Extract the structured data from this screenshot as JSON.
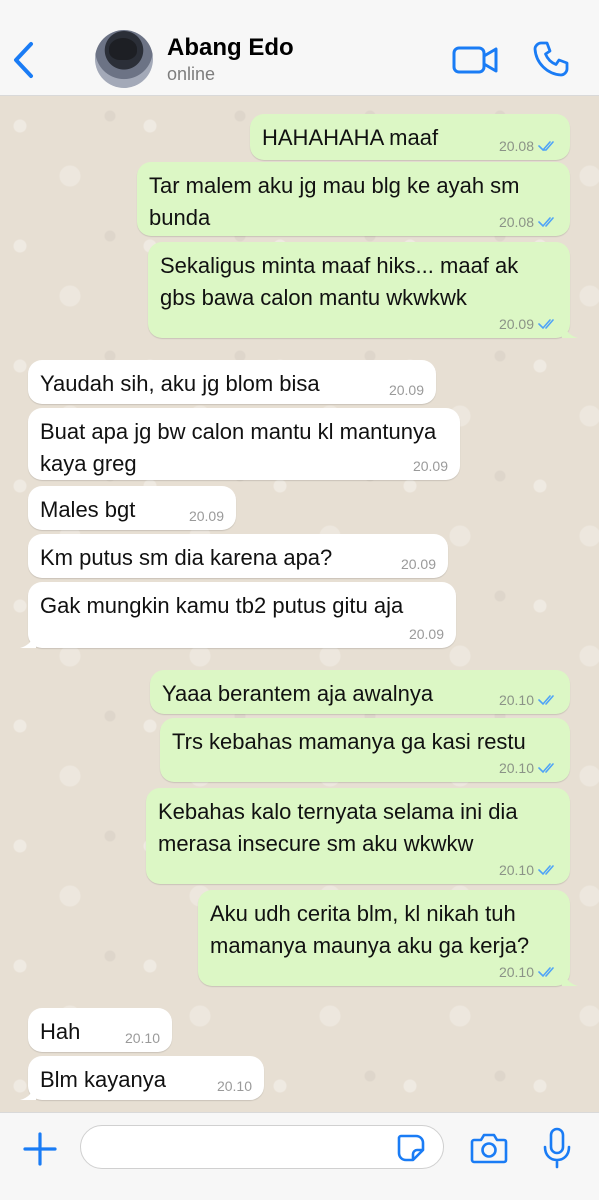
{
  "header": {
    "contact_name": "Abang Edo",
    "status": "online",
    "accent_color": "#1a7cf5"
  },
  "icons": {
    "back": "chevron-left-icon",
    "video": "video-camera-icon",
    "call": "phone-icon",
    "plus": "plus-icon",
    "sticker": "sticker-icon",
    "camera": "camera-icon",
    "mic": "microphone-icon"
  },
  "messages": [
    {
      "direction": "out",
      "text": "HAHAHAHA maaf",
      "time": "20.08",
      "read": true
    },
    {
      "direction": "out",
      "text": "Tar malem aku jg mau blg ke ayah sm bunda",
      "time": "20.08",
      "read": true
    },
    {
      "direction": "out",
      "text": "Sekaligus minta maaf hiks... maaf ak gbs bawa calon mantu wkwkwk",
      "time": "20.09",
      "read": true
    },
    {
      "direction": "in",
      "text": "Yaudah sih, aku jg blom bisa",
      "time": "20.09"
    },
    {
      "direction": "in",
      "text": "Buat apa jg bw calon mantu kl mantunya kaya greg",
      "time": "20.09"
    },
    {
      "direction": "in",
      "text": "Males bgt",
      "time": "20.09"
    },
    {
      "direction": "in",
      "text": "Km putus sm dia karena apa?",
      "time": "20.09"
    },
    {
      "direction": "in",
      "text": "Gak mungkin kamu tb2 putus gitu aja",
      "time": "20.09"
    },
    {
      "direction": "out",
      "text": "Yaaa berantem aja awalnya",
      "time": "20.10",
      "read": true
    },
    {
      "direction": "out",
      "text": "Trs kebahas mamanya ga kasi restu",
      "time": "20.10",
      "read": true
    },
    {
      "direction": "out",
      "text": "Kebahas kalo ternyata selama ini dia merasa insecure sm aku wkwkw",
      "time": "20.10",
      "read": true
    },
    {
      "direction": "out",
      "text": "Aku udh cerita blm, kl nikah tuh mamanya maunya aku ga kerja?",
      "time": "20.10",
      "read": true
    },
    {
      "direction": "in",
      "text": "Hah",
      "time": "20.10"
    },
    {
      "direction": "in",
      "text": "Blm kayanya",
      "time": "20.10"
    }
  ],
  "composer": {
    "input_value": "",
    "input_placeholder": ""
  },
  "colors": {
    "outgoing_bubble": "#dcf7c5",
    "incoming_bubble": "#ffffff",
    "read_ticks": "#4fa3f7",
    "chat_wallpaper": "#e7dfd3"
  }
}
